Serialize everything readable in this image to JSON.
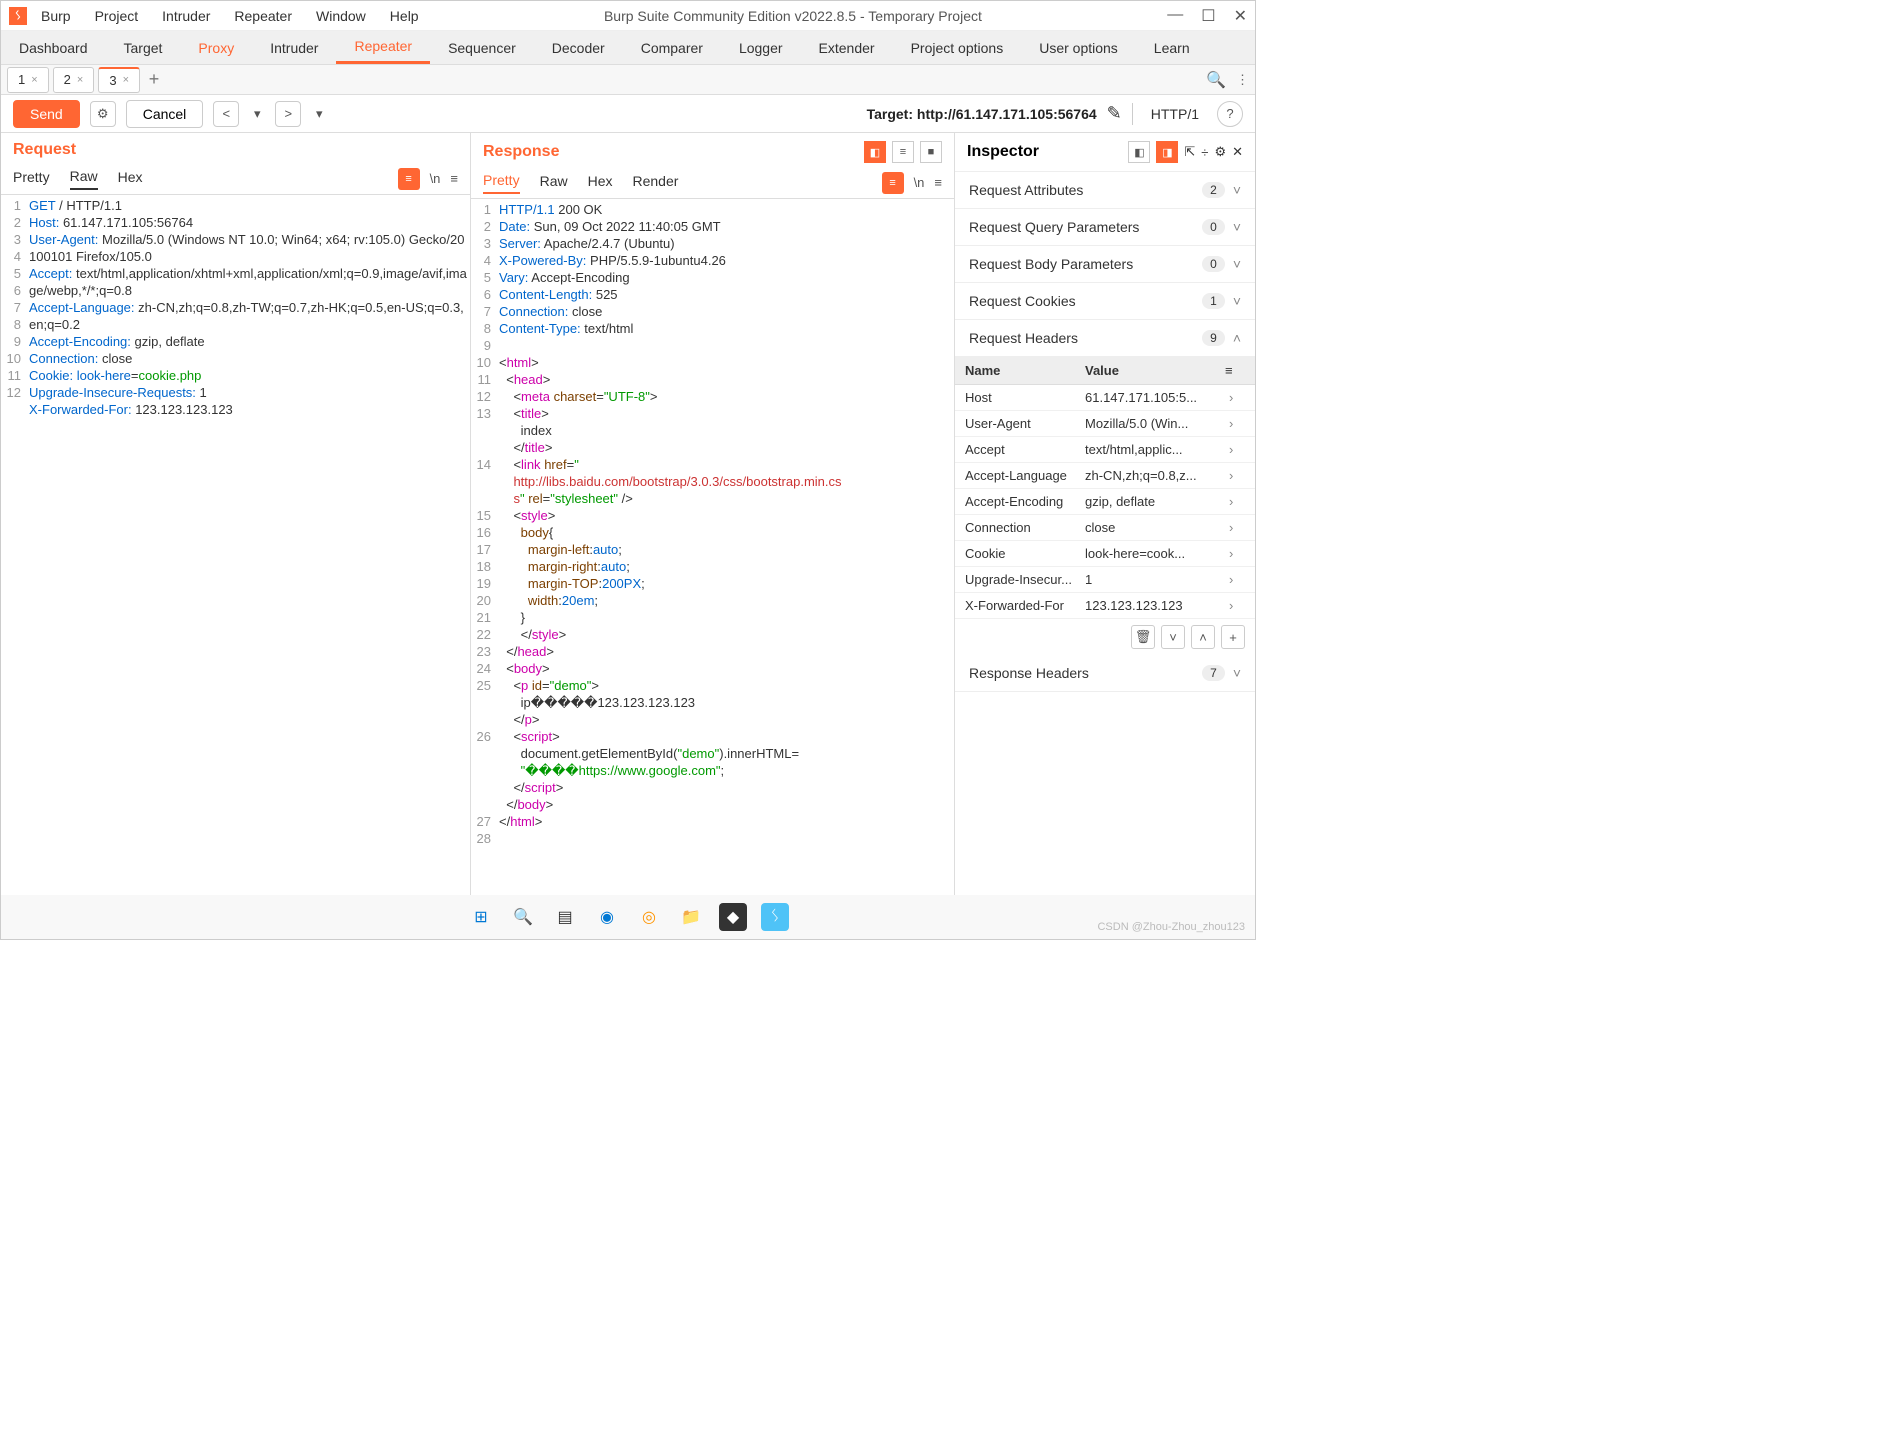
{
  "window": {
    "title": "Burp Suite Community Edition v2022.8.5 - Temporary Project"
  },
  "menu": [
    "Burp",
    "Project",
    "Intruder",
    "Repeater",
    "Window",
    "Help"
  ],
  "mainTabs": [
    "Dashboard",
    "Target",
    "Proxy",
    "Intruder",
    "Repeater",
    "Sequencer",
    "Decoder",
    "Comparer",
    "Logger",
    "Extender",
    "Project options",
    "User options",
    "Learn"
  ],
  "mainActive": 4,
  "mainAlt": 2,
  "subtabs": [
    "1",
    "2",
    "3"
  ],
  "subActive": 2,
  "toolbar": {
    "send": "Send",
    "cancel": "Cancel",
    "targetLabel": "Target: ",
    "target": "http://61.147.171.105:56764",
    "httpver": "HTTP/1"
  },
  "request": {
    "title": "Request",
    "views": [
      "Pretty",
      "Raw",
      "Hex"
    ],
    "active": 1,
    "lines": [
      {
        "n": 1,
        "html": "<span class='h'>GET</span> / HTTP/1.1"
      },
      {
        "n": 2,
        "html": "<span class='h'>Host:</span> 61.147.171.105:56764"
      },
      {
        "n": 3,
        "html": "<span class='h'>User-Agent:</span> Mozilla/5.0 (Windows NT 10.0; Win64; x64; rv:105.0) Gecko/20100101 Firefox/105.0"
      },
      {
        "n": 4,
        "html": "<span class='h'>Accept:</span> text/html,application/xhtml+xml,application/xml;q=0.9,image/avif,image/webp,*/*;q=0.8"
      },
      {
        "n": 5,
        "html": "<span class='h'>Accept-Language:</span> zh-CN,zh;q=0.8,zh-TW;q=0.7,zh-HK;q=0.5,en-US;q=0.3,en;q=0.2"
      },
      {
        "n": 6,
        "html": "<span class='h'>Accept-Encoding:</span> gzip, deflate"
      },
      {
        "n": 7,
        "html": "<span class='h'>Connection:</span> close"
      },
      {
        "n": 8,
        "html": "<span class='h'>Cookie:</span> <span class='h'>look-here</span>=<span class='s'>cookie.php</span>"
      },
      {
        "n": 9,
        "html": "<span class='h'>Upgrade-Insecure-Requests:</span> 1"
      },
      {
        "n": 10,
        "html": "<span class='h'>X-Forwarded-For:</span> 123.123.123.123"
      },
      {
        "n": 11,
        "html": ""
      },
      {
        "n": 12,
        "html": ""
      }
    ]
  },
  "response": {
    "title": "Response",
    "views": [
      "Pretty",
      "Raw",
      "Hex",
      "Render"
    ],
    "active": 0,
    "lines": [
      {
        "n": 1,
        "html": "<span class='h'>HTTP/1.1</span> 200 OK"
      },
      {
        "n": 2,
        "html": "<span class='h'>Date:</span> Sun, 09 Oct 2022 11:40:05 GMT"
      },
      {
        "n": 3,
        "html": "<span class='h'>Server:</span> Apache/2.4.7 (Ubuntu)"
      },
      {
        "n": 4,
        "html": "<span class='h'>X-Powered-By:</span> PHP/5.5.9-1ubuntu4.26"
      },
      {
        "n": 5,
        "html": "<span class='h'>Vary:</span> Accept-Encoding"
      },
      {
        "n": 6,
        "html": "<span class='h'>Content-Length:</span> 525"
      },
      {
        "n": 7,
        "html": "<span class='h'>Connection:</span> close"
      },
      {
        "n": 8,
        "html": "<span class='h'>Content-Type:</span> text/html"
      },
      {
        "n": 9,
        "html": ""
      },
      {
        "n": 10,
        "html": "&lt;<span class='t'>html</span>&gt;"
      },
      {
        "n": 11,
        "html": "&nbsp;&nbsp;&lt;<span class='t'>head</span>&gt;"
      },
      {
        "n": 12,
        "html": "&nbsp;&nbsp;&nbsp;&nbsp;&lt;<span class='t'>meta</span> <span class='a'>charset</span>=<span class='s'>\"UTF-8\"</span>&gt;"
      },
      {
        "n": 13,
        "html": "&nbsp;&nbsp;&nbsp;&nbsp;&lt;<span class='t'>title</span>&gt;<br>&nbsp;&nbsp;&nbsp;&nbsp;&nbsp;&nbsp;index<br>&nbsp;&nbsp;&nbsp;&nbsp;&lt;/<span class='t'>title</span>&gt;"
      },
      {
        "n": 14,
        "html": "&nbsp;&nbsp;&nbsp;&nbsp;&lt;<span class='t'>link</span> <span class='a'>href</span>=<span class='s'>\"</span><br><span class='r'>&nbsp;&nbsp;&nbsp;&nbsp;http://libs.baidu.com/bootstrap/3.0.3/css/bootstrap.min.cs</span><br><span class='r'>&nbsp;&nbsp;&nbsp;&nbsp;s</span><span class='s'>\"</span> <span class='a'>rel</span>=<span class='s'>\"stylesheet\"</span> /&gt;"
      },
      {
        "n": 15,
        "html": "&nbsp;&nbsp;&nbsp;&nbsp;&lt;<span class='t'>style</span>&gt;"
      },
      {
        "n": 16,
        "html": "&nbsp;&nbsp;&nbsp;&nbsp;&nbsp;&nbsp;<span class='a'>body</span>{"
      },
      {
        "n": 17,
        "html": "&nbsp;&nbsp;&nbsp;&nbsp;&nbsp;&nbsp;&nbsp;&nbsp;<span class='a'>margin-left</span>:<span class='h'>auto</span>;"
      },
      {
        "n": 18,
        "html": "&nbsp;&nbsp;&nbsp;&nbsp;&nbsp;&nbsp;&nbsp;&nbsp;<span class='a'>margin-right</span>:<span class='h'>auto</span>;"
      },
      {
        "n": 19,
        "html": "&nbsp;&nbsp;&nbsp;&nbsp;&nbsp;&nbsp;&nbsp;&nbsp;<span class='a'>margin-TOP</span>:<span class='h'>200PX</span>;"
      },
      {
        "n": 20,
        "html": "&nbsp;&nbsp;&nbsp;&nbsp;&nbsp;&nbsp;&nbsp;&nbsp;<span class='a'>width</span>:<span class='h'>20em</span>;"
      },
      {
        "n": 21,
        "html": "&nbsp;&nbsp;&nbsp;&nbsp;&nbsp;&nbsp;}"
      },
      {
        "n": 22,
        "html": "&nbsp;&nbsp;&nbsp;&nbsp;&nbsp;&nbsp;&lt;/<span class='t'>style</span>&gt;"
      },
      {
        "n": 23,
        "html": "&nbsp;&nbsp;&lt;/<span class='t'>head</span>&gt;"
      },
      {
        "n": 24,
        "html": "&nbsp;&nbsp;&lt;<span class='t'>body</span>&gt;"
      },
      {
        "n": 25,
        "html": "&nbsp;&nbsp;&nbsp;&nbsp;&lt;<span class='t'>p</span> <span class='a'>id</span>=<span class='s'>\"demo\"</span>&gt;<br>&nbsp;&nbsp;&nbsp;&nbsp;&nbsp;&nbsp;ip�����123.123.123.123<br>&nbsp;&nbsp;&nbsp;&nbsp;&lt;/<span class='t'>p</span>&gt;"
      },
      {
        "n": 26,
        "html": "&nbsp;&nbsp;&nbsp;&nbsp;&lt;<span class='t'>script</span>&gt;<br>&nbsp;&nbsp;&nbsp;&nbsp;&nbsp;&nbsp;document.getElementById(<span class='s'>\"demo\"</span>).innerHTML=<br>&nbsp;&nbsp;&nbsp;&nbsp;&nbsp;&nbsp;<span class='s'>\"����https://www.google.com\"</span>;<br>&nbsp;&nbsp;&nbsp;&nbsp;&lt;/<span class='t'>script</span>&gt;<br>&nbsp;&nbsp;&lt;/<span class='t'>body</span>&gt;"
      },
      {
        "n": 27,
        "html": "&lt;/<span class='t'>html</span>&gt;"
      },
      {
        "n": 28,
        "html": ""
      }
    ]
  },
  "inspector": {
    "title": "Inspector",
    "sections": [
      {
        "label": "Request Attributes",
        "count": "2",
        "open": false
      },
      {
        "label": "Request Query Parameters",
        "count": "0",
        "open": false
      },
      {
        "label": "Request Body Parameters",
        "count": "0",
        "open": false
      },
      {
        "label": "Request Cookies",
        "count": "1",
        "open": false
      },
      {
        "label": "Request Headers",
        "count": "9",
        "open": true
      }
    ],
    "headersCols": {
      "name": "Name",
      "value": "Value"
    },
    "headers": [
      {
        "name": "Host",
        "value": "61.147.171.105:5..."
      },
      {
        "name": "User-Agent",
        "value": "Mozilla/5.0 (Win..."
      },
      {
        "name": "Accept",
        "value": "text/html,applic..."
      },
      {
        "name": "Accept-Language",
        "value": "zh-CN,zh;q=0.8,z..."
      },
      {
        "name": "Accept-Encoding",
        "value": "gzip, deflate"
      },
      {
        "name": "Connection",
        "value": "close"
      },
      {
        "name": "Cookie",
        "value": "look-here=cook..."
      },
      {
        "name": "Upgrade-Insecur...",
        "value": "1"
      },
      {
        "name": "X-Forwarded-For",
        "value": "123.123.123.123"
      }
    ],
    "responseHeaders": {
      "label": "Response Headers",
      "count": "7"
    }
  },
  "watermark": "CSDN @Zhou-Zhou_zhou123"
}
